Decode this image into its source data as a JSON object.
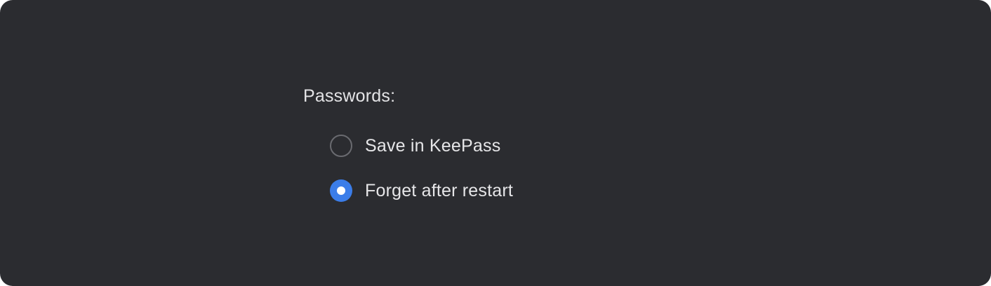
{
  "passwords": {
    "label": "Passwords:",
    "options": [
      {
        "label": "Save in KeePass",
        "selected": false
      },
      {
        "label": "Forget after restart",
        "selected": true
      }
    ]
  },
  "colors": {
    "background": "#2b2c30",
    "accent": "#3b7de9",
    "radio_border": "#6a6b70",
    "text": "#e6e6e8"
  }
}
